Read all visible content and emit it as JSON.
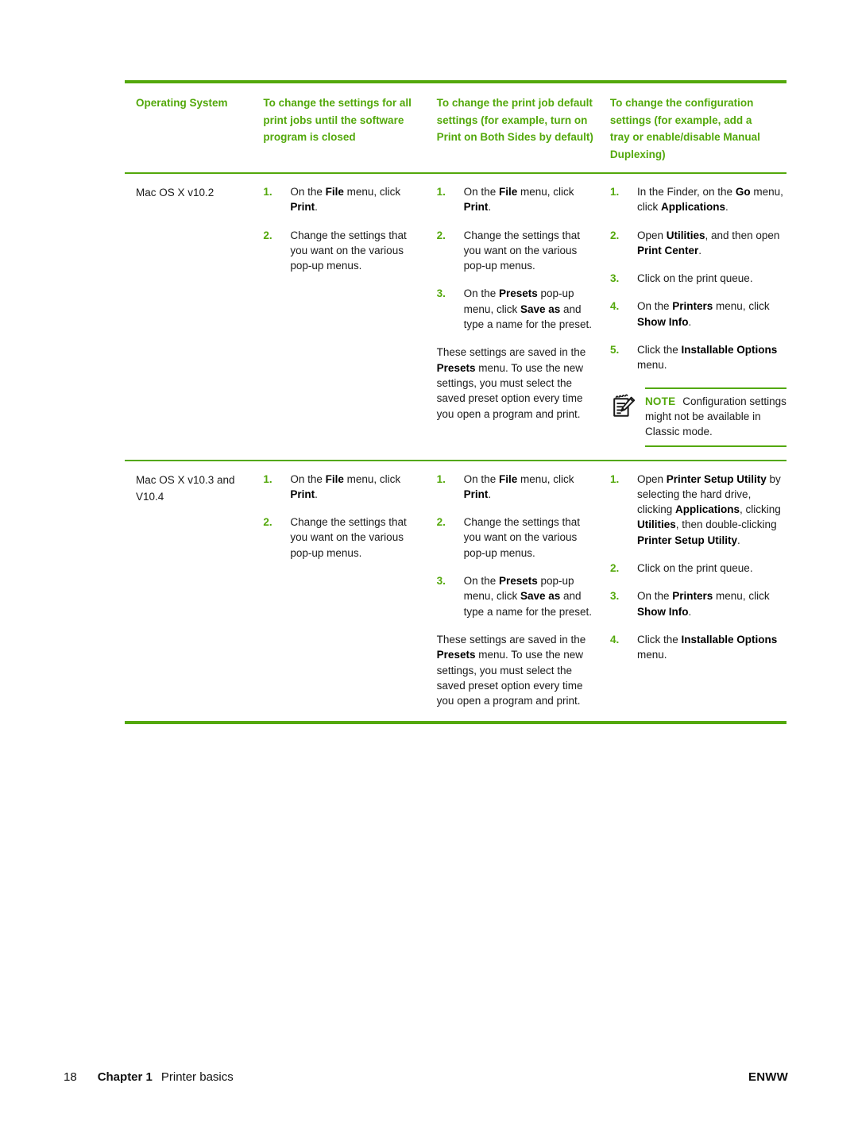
{
  "table": {
    "headers": [
      "Operating System",
      "To change the settings for all print jobs until the software program is closed",
      "To change the print job default settings (for example, turn on Print on Both Sides by default)",
      "To change the configuration settings (for example, add a tray or enable/disable Manual Duplexing)"
    ],
    "rows": [
      {
        "os": "Mac OS X v10.2",
        "col_all_jobs": {
          "steps": [
            {
              "num": "1.",
              "html": "On the <b>File</b> menu, click <b>Print</b>."
            },
            {
              "num": "2.",
              "html": "Change the settings that you want on the various pop-up menus."
            }
          ]
        },
        "col_job_default": {
          "steps": [
            {
              "num": "1.",
              "html": "On the <b>File</b> menu, click <b>Print</b>."
            },
            {
              "num": "2.",
              "html": "Change the settings that you want on the various pop-up menus."
            },
            {
              "num": "3.",
              "html": "On the <b>Presets</b> pop-up menu, click <b>Save as</b> and type a name for the preset."
            }
          ],
          "paragraph": "These settings are saved in the <b>Presets</b> menu. To use the new settings, you must select the saved preset option every time you open a program and print."
        },
        "col_configuration": {
          "steps": [
            {
              "num": "1.",
              "html": "In the Finder, on the <b>Go</b> menu, click <b>Applications</b>."
            },
            {
              "num": "2.",
              "html": "Open <b>Utilities</b>, and then open <b>Print Center</b>."
            },
            {
              "num": "3.",
              "html": "Click on the print queue."
            },
            {
              "num": "4.",
              "html": "On the <b>Printers</b> menu, click <b>Show Info</b>."
            },
            {
              "num": "5.",
              "html": "Click the <b>Installable Options</b> menu."
            }
          ],
          "note": {
            "icon": "note-pad-pencil-icon",
            "keyword": "NOTE",
            "text": "Configuration settings might not be available in Classic mode."
          }
        }
      },
      {
        "os": "Mac OS X v10.3 and V10.4",
        "col_all_jobs": {
          "steps": [
            {
              "num": "1.",
              "html": "On the <b>File</b> menu, click <b>Print</b>."
            },
            {
              "num": "2.",
              "html": "Change the settings that you want on the various pop-up menus."
            }
          ]
        },
        "col_job_default": {
          "steps": [
            {
              "num": "1.",
              "html": "On the <b>File</b> menu, click <b>Print</b>."
            },
            {
              "num": "2.",
              "html": "Change the settings that you want on the various pop-up menus."
            },
            {
              "num": "3.",
              "html": "On the <b>Presets</b> pop-up menu, click <b>Save as</b> and type a name for the preset."
            }
          ],
          "paragraph": "These settings are saved in the <b>Presets</b> menu. To use the new settings, you must select the saved preset option every time you open a program and print."
        },
        "col_configuration": {
          "steps": [
            {
              "num": "1.",
              "html": "Open <b>Printer Setup Utility</b> by selecting the hard drive, clicking <b>Applications</b>, clicking <b>Utilities</b>, then double-clicking <b>Printer Setup Utility</b>."
            },
            {
              "num": "2.",
              "html": "Click on the print queue."
            },
            {
              "num": "3.",
              "html": "On the <b>Printers</b> menu, click <b>Show Info</b>."
            },
            {
              "num": "4.",
              "html": "Click the <b>Installable Options</b> menu."
            }
          ]
        }
      }
    ]
  },
  "footer": {
    "page_number": "18",
    "chapter": "Chapter 1",
    "chapter_title": "Printer basics",
    "right_label": "ENWW"
  },
  "colors": {
    "accent_green": "#53a80b",
    "body_text": "#1a1a1a"
  }
}
